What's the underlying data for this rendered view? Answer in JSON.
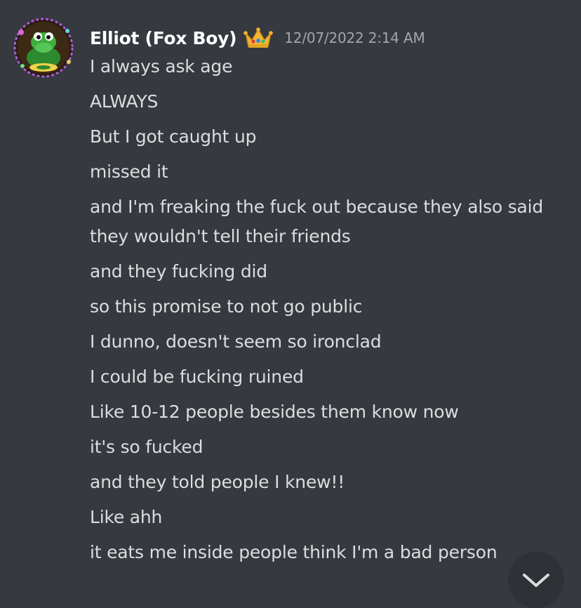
{
  "message": {
    "username": "Elliot (Fox Boy)",
    "timestamp": "12/07/2022 2:14 AM",
    "lines": [
      "I always ask age",
      "ALWAYS",
      "But I got caught up",
      "missed it",
      "and I'm freaking the fuck out because they also said they wouldn't tell their friends",
      "and they fucking did",
      "so this promise to not go public",
      "I dunno, doesn't seem so ironclad",
      "I could be fucking ruined",
      "Like 10-12 people besides them know now",
      "it's so fucked",
      "and they told people I knew!!",
      "Like ahh",
      "it eats me inside people think I'm a bad person"
    ]
  },
  "icons": {
    "avatar": "green-creature-avatar",
    "badge": "crown-icon",
    "jump": "chevron-down-icon"
  },
  "colors": {
    "background": "#36393f",
    "username": "#ffffff",
    "text": "#dcddde",
    "timestamp": "#a3a6aa",
    "jump_button": "#2f3136"
  }
}
